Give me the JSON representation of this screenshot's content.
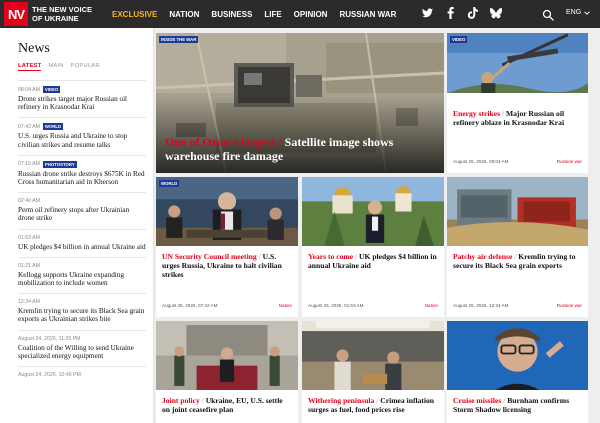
{
  "brand": {
    "logo_letters": "NV",
    "name": "The New Voice of Ukraine"
  },
  "nav": {
    "items": [
      {
        "label": "Exclusive",
        "accent": true
      },
      {
        "label": "Nation"
      },
      {
        "label": "Business"
      },
      {
        "label": "Life"
      },
      {
        "label": "Opinion"
      },
      {
        "label": "Russian war"
      }
    ],
    "social_icons": [
      "twitter-icon",
      "facebook-icon",
      "tiktok-icon",
      "bluesky-icon"
    ],
    "language": "ENG"
  },
  "sidebar": {
    "title": "News",
    "tabs": [
      {
        "label": "Latest",
        "active": true
      },
      {
        "label": "Main"
      },
      {
        "label": "Popular"
      }
    ],
    "items": [
      {
        "time": "08:04 AM",
        "badge": "Video",
        "headline": "Drone strikes target major Russian oil refinery in Krasnodar Krai"
      },
      {
        "time": "07:42 AM",
        "badge": "World",
        "headline": "U.S. urges Russia and Ukraine to stop civilian strikes and resume talks"
      },
      {
        "time": "07:15 AM",
        "badge": "Photostory",
        "headline": "Russian drone strike destroys $675K in Red Cross humanitarian aid in Kherson"
      },
      {
        "time": "02:40 AM",
        "badge": "",
        "headline": "Perm oil refinery stops after Ukrainian drone strike"
      },
      {
        "time": "01:53 AM",
        "badge": "",
        "headline": "UK pledges $4 billion in annual Ukraine aid"
      },
      {
        "time": "01:21 AM",
        "badge": "",
        "headline": "Kellogg supports Ukraine expanding mobilization to include women"
      },
      {
        "time": "12:34 AM",
        "badge": "",
        "headline": "Kremlin trying to secure its Black Sea grain exports as Ukrainian strikes bite"
      },
      {
        "time": "August 24, 2026, 11:29 PM",
        "badge": "",
        "headline": "Coalition of the Willing to send Ukraine specialized energy equipment"
      },
      {
        "time": "August 24, 2026, 10:46 PM",
        "badge": "",
        "headline": ""
      }
    ]
  },
  "hero": {
    "badge": "Inside the war",
    "highlight": "One of Ozon's largest",
    "separator": " / ",
    "rest": "Satellite image shows warehouse fire damage"
  },
  "cards": [
    {
      "badge": "Video",
      "highlight": "Energy strikes",
      "rest": "Major Russian oil refinery ablaze in Krasnodar Krai",
      "date": "August 25, 2026, 08:04 AM",
      "category": "Russian war"
    },
    {
      "badge": "World",
      "highlight": "UN Security Council meeting",
      "rest": "U.S. urges Russia, Ukraine to halt civilian strikes",
      "date": "August 25, 2026, 07:42 AM",
      "category": "Nation"
    },
    {
      "badge": "",
      "highlight": "Years to come",
      "rest": "UK pledges $4 billion in annual Ukraine aid",
      "date": "August 25, 2026, 01:53 AM",
      "category": "Nation"
    },
    {
      "badge": "",
      "highlight": "Patchy air defense",
      "rest": "Kremlin trying to secure its Black Sea grain exports",
      "date": "August 25, 2026, 12:34 AM",
      "category": "Russian war"
    },
    {
      "badge": "",
      "highlight": "Joint policy",
      "rest": "Ukraine, EU, U.S. settle on joint ceasefire plan",
      "date": "",
      "category": ""
    },
    {
      "badge": "",
      "highlight": "Withering peninsula",
      "rest": "Crimea inflation surges as fuel, food prices rise",
      "date": "",
      "category": ""
    },
    {
      "badge": "",
      "highlight": "Cruise missiles",
      "rest": "Burnham confirms Storm Shadow licensing",
      "date": "",
      "category": ""
    }
  ],
  "colors": {
    "accent": "#e2001a",
    "nav_bg": "#2b2b2b",
    "exclusive": "#f6b418",
    "badge": "#1f3a93"
  }
}
